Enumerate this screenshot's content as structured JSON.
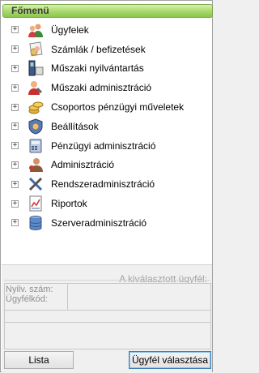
{
  "header": {
    "title": "Főmenü"
  },
  "menu": [
    {
      "label": "Ügyfelek",
      "icon": "people-icon"
    },
    {
      "label": "Számlák / befizetések",
      "icon": "invoice-icon"
    },
    {
      "label": "Műszaki nyilvántartás",
      "icon": "device-icon"
    },
    {
      "label": "Műszaki adminisztráció",
      "icon": "technician-icon"
    },
    {
      "label": "Csoportos pénzügyi műveletek",
      "icon": "coins-icon"
    },
    {
      "label": "Beállítások",
      "icon": "shield-settings-icon"
    },
    {
      "label": "Pénzügyi adminisztráció",
      "icon": "calculator-icon"
    },
    {
      "label": "Adminisztráció",
      "icon": "admin-user-icon"
    },
    {
      "label": "Rendszeradminisztráció",
      "icon": "tools-icon"
    },
    {
      "label": "Riportok",
      "icon": "report-chart-icon"
    },
    {
      "label": "Szerveradminisztráció",
      "icon": "database-icon"
    }
  ],
  "expander_glyph": "+",
  "selected_customer": {
    "caption": "A kiválasztott ügyfél:",
    "account_label": "Nyilv. szám:",
    "code_label": "Ügyfélkód:"
  },
  "buttons": {
    "list": "Lista",
    "select_customer": "Ügyfél választása"
  }
}
